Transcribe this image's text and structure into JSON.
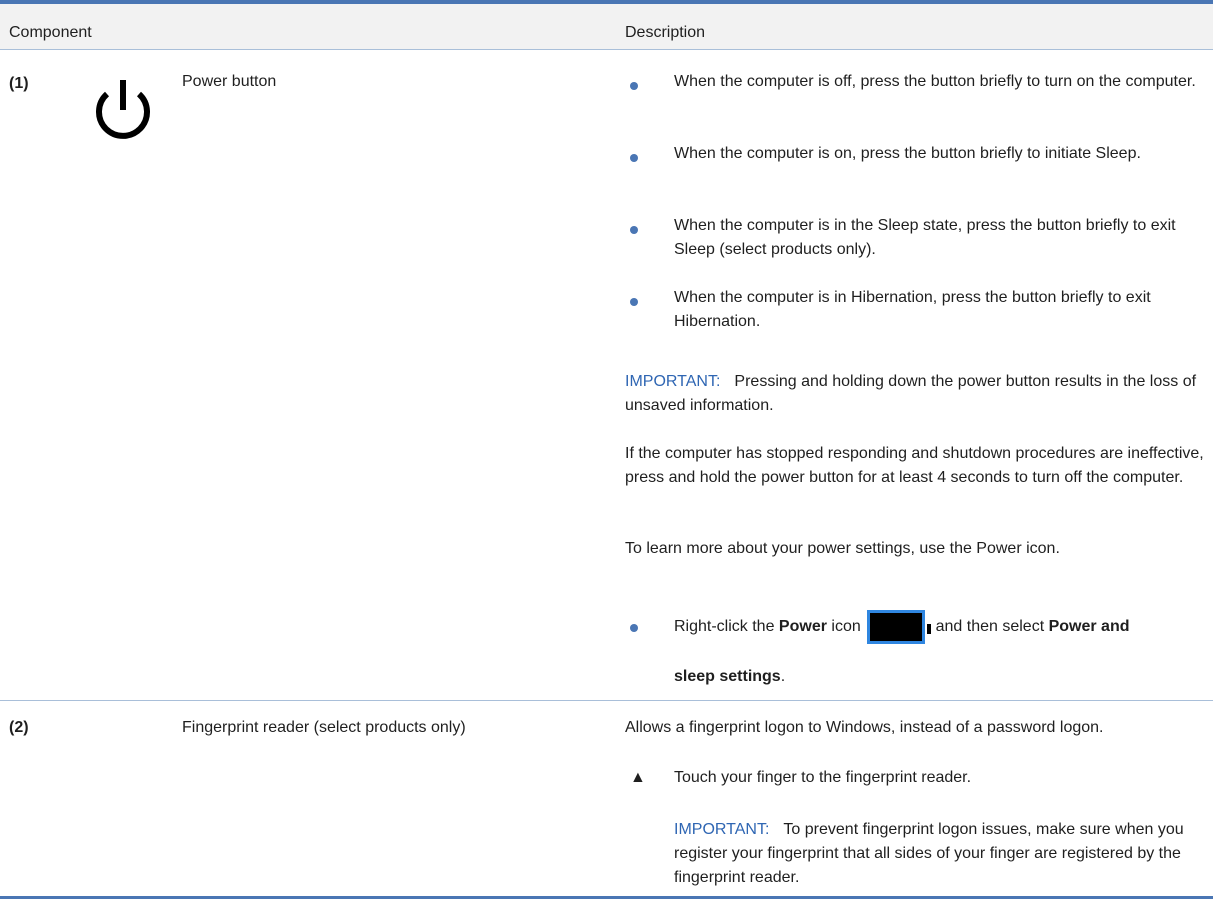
{
  "table": {
    "headers": {
      "component": "Component",
      "description": "Description"
    },
    "rows": [
      {
        "number": "(1)",
        "icon": "power-icon",
        "component": "Power button",
        "bullets": [
          "When the computer is off, press the button briefly to turn on the computer.",
          "When the computer is on, press the button briefly to initiate Sleep.",
          "When the computer is in the Sleep state, press the button briefly to exit Sleep (select products only).",
          "When the computer is in Hibernation, press the button briefly to exit Hibernation."
        ],
        "important_label": "IMPORTANT:",
        "important_text": "Pressing and holding down the power button results in the loss of unsaved information.",
        "paragraph1": "If the computer has stopped responding and shutdown procedures are ineffective, press and hold the power button for at least 4 seconds to turn off the computer.",
        "paragraph2": "To learn more about your power settings, use the Power icon.",
        "last_bullet": {
          "part1": "Right-click the ",
          "bold1": "Power",
          "part2": " icon",
          "battery_icon": "battery-icon",
          "part3": ", and then select ",
          "bold2": "Power and",
          "bold3": "sleep settings",
          "end": "."
        }
      },
      {
        "number": "(2)",
        "component": "Fingerprint reader (select products only)",
        "description": "Allows a fingerprint logon to Windows, instead of a password logon.",
        "step_marker": "▲",
        "step": "Touch your finger to the fingerprint reader.",
        "important_label": "IMPORTANT:",
        "important_text": "To prevent fingerprint logon issues, make sure when you register your fingerprint that all sides of your finger are registered by the fingerprint reader."
      }
    ]
  },
  "colors": {
    "accent": "#4a76b4",
    "important": "#2f66b3",
    "header_bg": "#f2f2f2"
  }
}
